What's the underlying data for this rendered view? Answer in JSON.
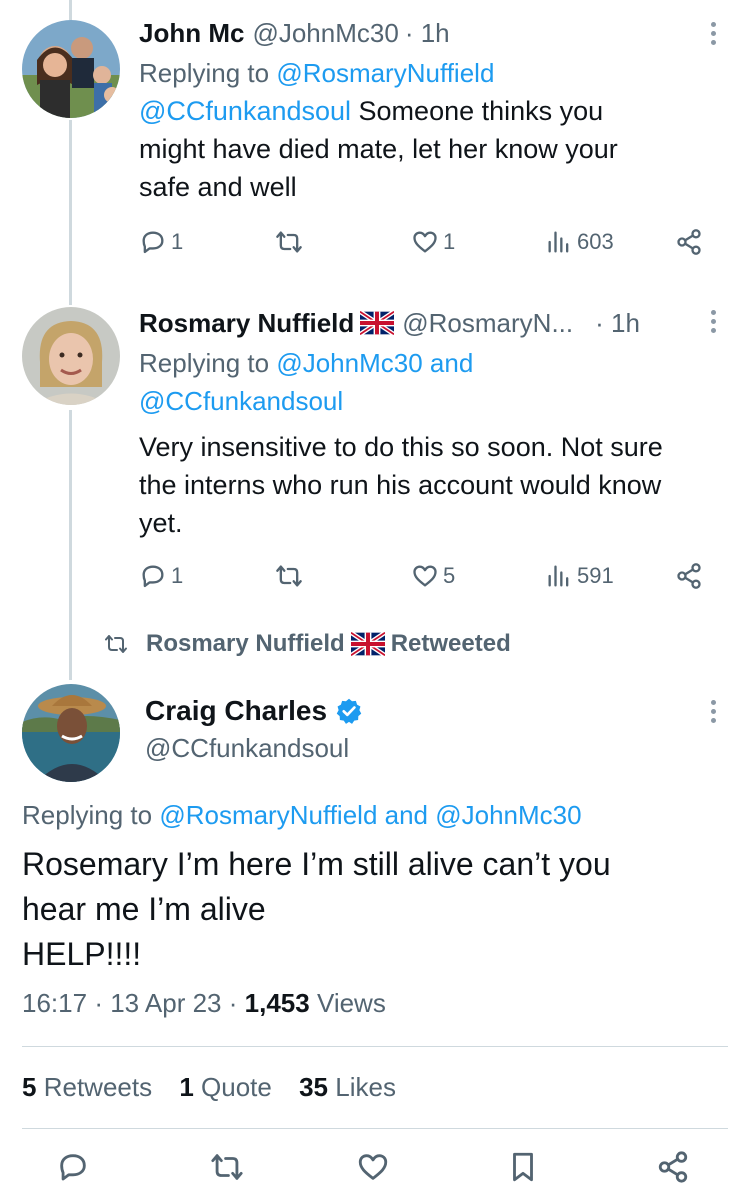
{
  "tweets": [
    {
      "name": "John Mc",
      "handle": "@JohnMc30",
      "time": "· 1h",
      "replying_prefix": "Replying to ",
      "replying_to": "@RosmaryNuffield",
      "mention": "@CCfunkandsoul",
      "text_line1": " Someone thinks you",
      "text_line2": "might have died mate, let her know your",
      "text_line3": "safe and well",
      "replies": "1",
      "retweets": "",
      "likes": "1",
      "views": "603"
    },
    {
      "name": "Rosmary Nuffield",
      "handle": "@RosmaryN...",
      "time": "· 1h",
      "replying_prefix": "Replying to ",
      "replying_to_1": "@JohnMc30",
      "replying_and": " and",
      "replying_to_2": "@CCfunkandsoul",
      "text_line1": "Very insensitive to do this so soon. Not sure",
      "text_line2": "the interns who run his account would know",
      "text_line3": "yet.",
      "replies": "1",
      "retweets": "",
      "likes": "5",
      "views": "591"
    }
  ],
  "retweeted_banner": {
    "name": "Rosmary Nuffield",
    "label": "Retweeted"
  },
  "main_tweet": {
    "name": "Craig Charles",
    "handle": "@CCfunkandsoul",
    "replying_prefix": "Replying to ",
    "replying_to_1": "@RosmaryNuffield",
    "replying_and": " and ",
    "replying_to_2": "@JohnMc30",
    "text_line1": "Rosemary I’m here I’m still alive can’t you",
    "text_line2": "hear me I’m alive",
    "text_line3": "HELP!!!!",
    "time": "16:17",
    "date": "13 Apr 23",
    "views_count": "1,453",
    "views_label": "Views",
    "retweets_count": "5",
    "retweets_label": "Retweets",
    "quotes_count": "1",
    "quotes_label": "Quote",
    "likes_count": "35",
    "likes_label": "Likes"
  },
  "colors": {
    "link": "#1d9bf0",
    "muted": "#536471",
    "verified": "#1d9bf0"
  },
  "icons": {
    "reply": "reply-icon",
    "retweet": "retweet-icon",
    "like": "heart-icon",
    "views": "views-icon",
    "share": "share-icon",
    "bookmark": "bookmark-icon",
    "more": "more-icon",
    "verified": "verified-badge-icon",
    "flag": "uk-flag-icon"
  }
}
